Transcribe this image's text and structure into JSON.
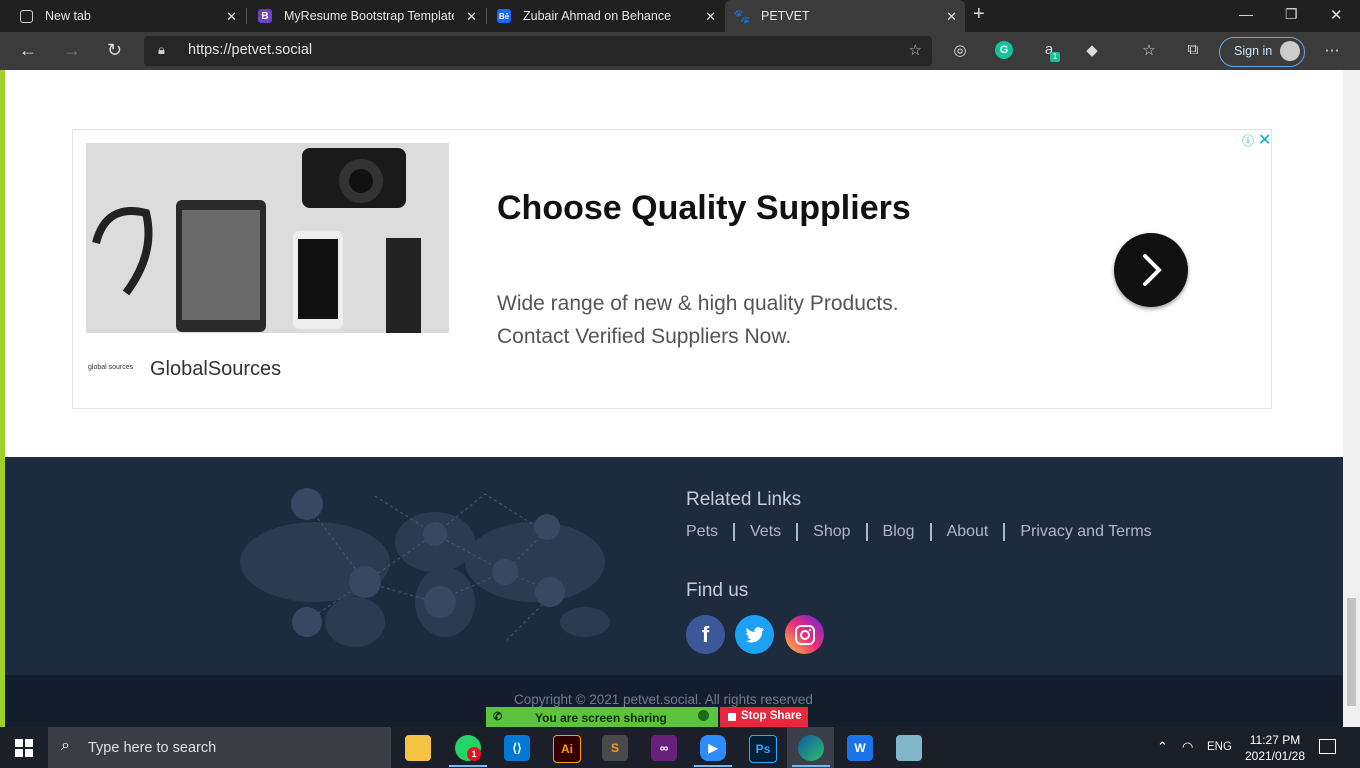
{
  "browser": {
    "tabs": [
      {
        "label": "New tab",
        "icon": "newtab-icon"
      },
      {
        "label": "MyResume Bootstrap Template -",
        "icon": "bootstrap-icon"
      },
      {
        "label": "Zubair Ahmad on Behance",
        "icon": "behance-icon"
      },
      {
        "label": "PETVET",
        "icon": "paw-icon"
      }
    ],
    "active_tab": 3,
    "url": "https://petvet.social",
    "sign_in": "Sign in",
    "extension_badge": "1"
  },
  "ad": {
    "headline": "Choose Quality Suppliers",
    "description_line1": "Wide range of new & high quality Products.",
    "description_line2": "Contact Verified Suppliers Now.",
    "advertiser": "GlobalSources",
    "advertiser_logo_text": "global sources"
  },
  "footer": {
    "related_title": "Related Links",
    "links": [
      "Pets",
      "Vets",
      "Shop",
      "Blog",
      "About",
      "Privacy and Terms"
    ],
    "find_us_title": "Find us",
    "social": [
      {
        "name": "facebook-icon",
        "color": "#3b5998"
      },
      {
        "name": "twitter-icon",
        "color": "#1da1f2"
      },
      {
        "name": "instagram-icon",
        "color": "#d6249f"
      }
    ],
    "copyright": "Copyright © 2021 petvet.social. All rights reserved"
  },
  "screen_share": {
    "status": "You are screen sharing",
    "stop": "Stop Share"
  },
  "taskbar": {
    "search_placeholder": "Type here to search",
    "whatsapp_badge": "1",
    "language": "ENG",
    "time": "11:27 PM",
    "date": "2021/01/28"
  },
  "colors": {
    "footer_bg": "#1e2a3e",
    "page_border": "#9fd12a",
    "ad_accent": "#00aecd"
  }
}
